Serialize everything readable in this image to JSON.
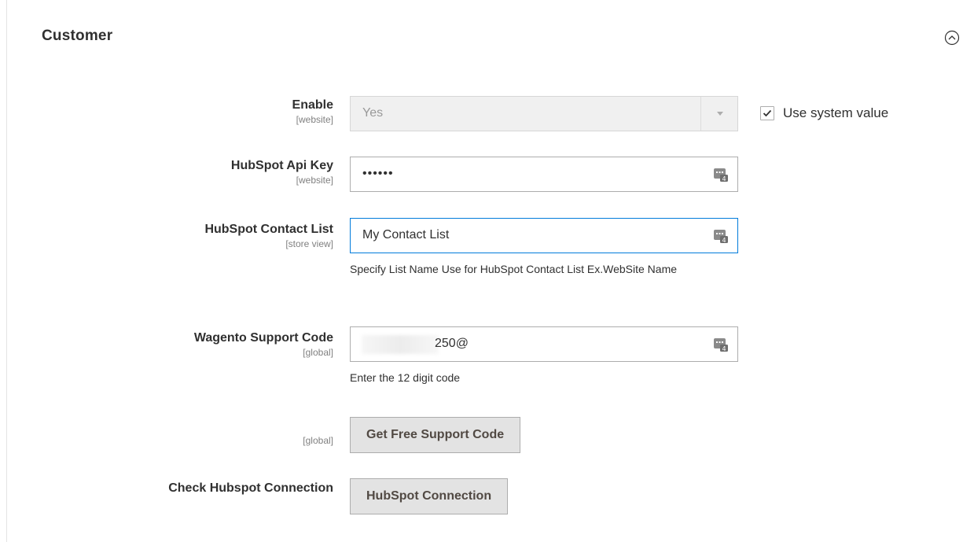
{
  "section": {
    "title": "Customer",
    "collapse_icon": "chevron-up-circle-icon"
  },
  "fields": {
    "enable": {
      "label": "Enable",
      "scope": "[website]",
      "value": "Yes",
      "use_system_value_label": "Use system value",
      "use_system_value_checked": true
    },
    "api_key": {
      "label": "HubSpot Api Key",
      "scope": "[website]",
      "value": "••••••",
      "icon": "password-keyboard-icon"
    },
    "contact_list": {
      "label": "HubSpot Contact List",
      "scope": "[store view]",
      "value": "My Contact List",
      "note": "Specify List Name Use for HubSpot Contact List Ex.WebSite Name",
      "icon": "password-keyboard-icon"
    },
    "support_code": {
      "label": "Wagento Support Code",
      "scope": "[global]",
      "value": "250@",
      "note": "Enter the 12 digit code",
      "icon": "password-keyboard-icon"
    },
    "free_support": {
      "scope": "[global]",
      "button_label": "Get Free Support Code"
    },
    "connection": {
      "label": "Check Hubspot Connection",
      "button_label": "HubSpot Connection"
    }
  },
  "colors": {
    "focus_border": "#007bdb",
    "button_bg": "#e3e3e3",
    "disabled_bg": "#f0f0f0"
  }
}
